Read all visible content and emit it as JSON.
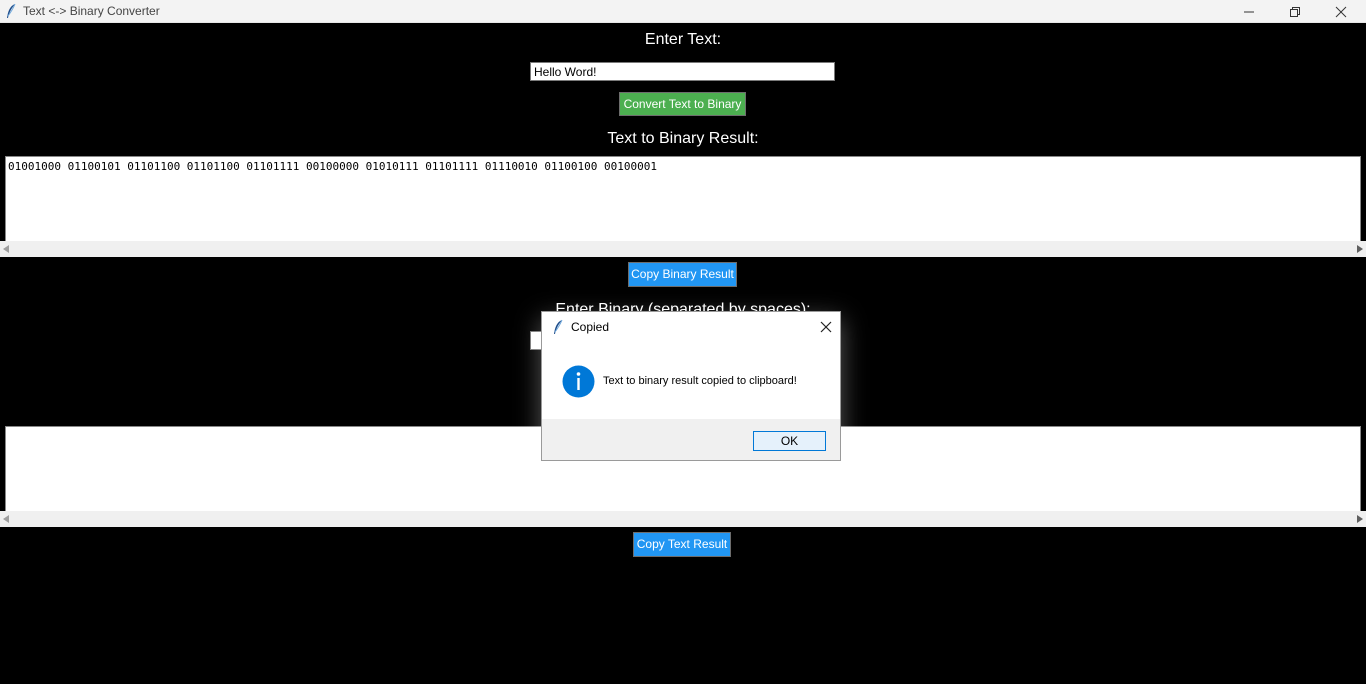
{
  "window": {
    "title": "Text <-> Binary Converter"
  },
  "text_section": {
    "label": "Enter Text:",
    "input_value": "Hello Word!",
    "convert_button": "Convert Text to Binary",
    "result_label": "Text to Binary Result:",
    "result_value": "01001000 01100101 01101100 01101100 01101111 00100000 01010111 01101111 01110010 01100100 00100001",
    "copy_button": "Copy Binary Result"
  },
  "binary_section": {
    "label": "Enter Binary (separated by spaces):",
    "input_value": "",
    "result_value": "",
    "copy_button": "Copy Text Result"
  },
  "dialog": {
    "title": "Copied",
    "message": "Text to binary result copied to clipboard!",
    "ok_button": "OK",
    "icon": "info-icon"
  },
  "colors": {
    "background": "#000000",
    "convert_button": "#4caf50",
    "copy_button": "#2196f3",
    "info_icon": "#0078d7"
  }
}
